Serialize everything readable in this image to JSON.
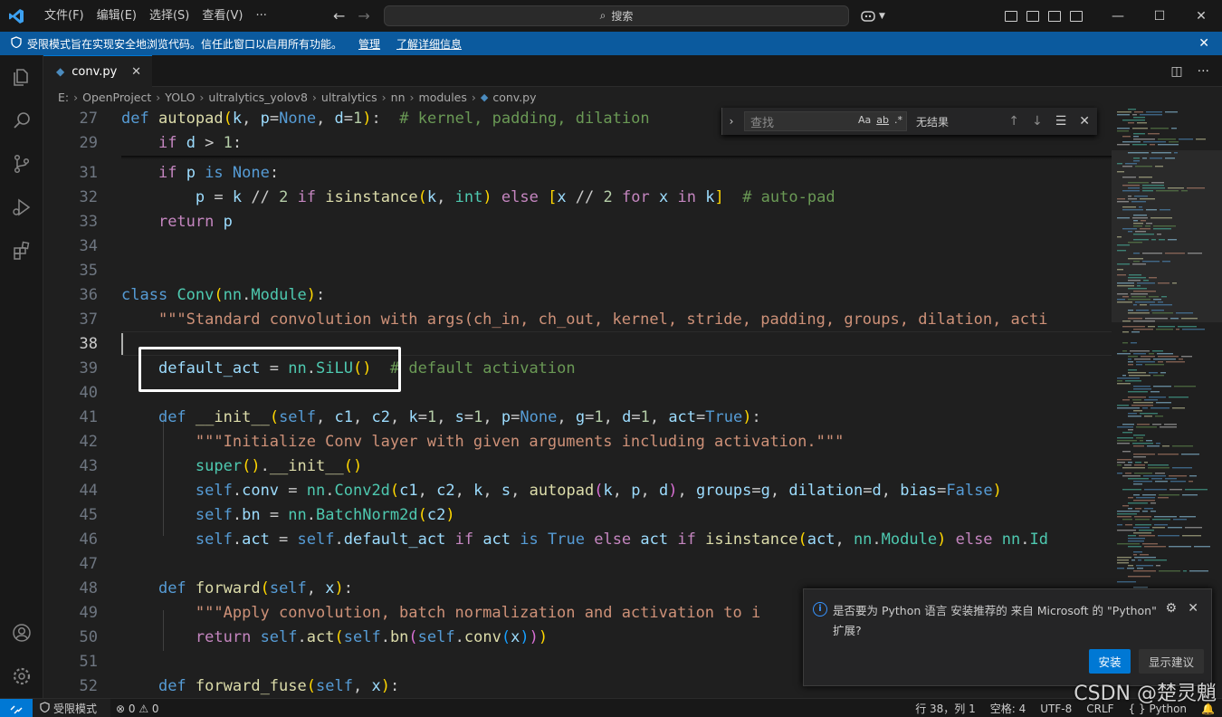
{
  "titlebar": {
    "menus": [
      "文件(F)",
      "编辑(E)",
      "选择(S)",
      "查看(V)",
      "···"
    ],
    "search_placeholder": "搜索",
    "controls": [
      "—",
      "☐",
      "✕"
    ]
  },
  "banner": {
    "text": "受限模式旨在实现安全地浏览代码。信任此窗口以启用所有功能。",
    "manage": "管理",
    "learn_more": "了解详细信息"
  },
  "tab": {
    "filename": "conv.py"
  },
  "breadcrumb": [
    "E:",
    "OpenProject",
    "YOLO",
    "ultralytics_yolov8",
    "ultralytics",
    "nn",
    "modules",
    "conv.py"
  ],
  "editor": {
    "line_numbers": [
      "27",
      "29",
      "31",
      "32",
      "33",
      "34",
      "35",
      "36",
      "37",
      "38",
      "39",
      "40",
      "41",
      "42",
      "43",
      "44",
      "45",
      "46",
      "47",
      "48",
      "49",
      "50",
      "51",
      "52"
    ],
    "active_line": "38"
  },
  "find": {
    "placeholder": "查找",
    "opt_case": "Aa",
    "opt_word": "ab",
    "opt_regex": ".*",
    "result": "无结果"
  },
  "notification": {
    "message": "是否要为 Python 语言 安装推荐的 来自 Microsoft 的 \"Python\" 扩展?",
    "install": "安装",
    "show_recommendations": "显示建议"
  },
  "statusbar": {
    "restricted": "受限模式",
    "problems": "⊗ 0 ⚠ 0",
    "position": "行 38，列 1",
    "spaces": "空格: 4",
    "encoding": "UTF-8",
    "eol": "CRLF",
    "language": "{ } Python"
  },
  "watermark": "CSDN @楚灵魈",
  "colors": {
    "accent": "#0078d4",
    "banner": "#0b5a9e",
    "keyword": "#569cd6",
    "function": "#dcdcaa",
    "class": "#4ec9b0",
    "comment": "#6a9955",
    "string": "#ce9178"
  }
}
